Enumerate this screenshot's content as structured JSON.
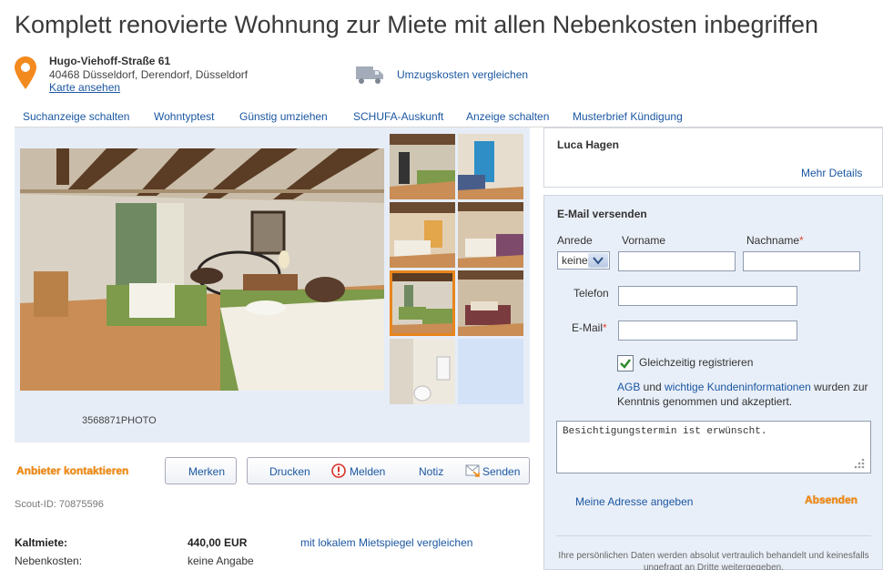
{
  "listing": {
    "title": "Komplett renovierte Wohnung zur Miete mit allen Nebenkosten inbegriffen",
    "street": "Hugo-Viehoff-Straße 61",
    "city": "40468 Düsseldorf, Derendorf, Düsseldorf",
    "map_link": "Karte ansehen",
    "move_link": "Umzugskosten vergleichen",
    "photo_caption": "3568871PHOTO",
    "scout_id": "Scout-ID: 70875596"
  },
  "nav": {
    "items": [
      "Suchanzeige schalten",
      "Wohntyptest",
      "Günstig umziehen",
      "SCHUFA-Auskunft",
      "Anzeige schalten",
      "Musterbrief Kündigung"
    ]
  },
  "actions": {
    "contact": "Anbieter kontaktieren",
    "remember": "Merken",
    "print": "Drucken",
    "report": "Melden",
    "note": "Notiz",
    "send": "Senden"
  },
  "costs": {
    "rent_label": "Kaltmiete:",
    "rent_value": "440,00 EUR",
    "rent_link": "mit lokalem Mietspiegel vergleichen",
    "extra_label": "Nebenkosten:",
    "extra_value": "keine Angabe"
  },
  "agent": {
    "name": "Luca Hagen",
    "more": "Mehr Details"
  },
  "form": {
    "title": "E-Mail versenden",
    "salutation_label": "Anrede",
    "salutation_value": "keine",
    "firstname_label": "Vorname",
    "lastname_label": "Nachname",
    "phone_label": "Telefon",
    "email_label": "E-Mail",
    "required_mark": "*",
    "register_label": "Gleichzeitig registrieren",
    "agb_link": "AGB",
    "agb_and": " und ",
    "info_link": "wichtige Kundeninformationen",
    "agb_rest": " wurden zur Kenntnis genommen und akzeptiert.",
    "message": "Besichtigungstermin ist erwünscht.",
    "address_link": "Meine Adresse angeben",
    "submit": "Absenden",
    "privacy": "Ihre persönlichen Daten werden absolut vertraulich behandelt und keinesfalls ungefragt an Dritte weitergegeben."
  },
  "colors": {
    "link": "#1b57a1",
    "accent_orange": "#f08a13",
    "panel_bg": "#e9eff8",
    "pin": "#f28a1d"
  }
}
